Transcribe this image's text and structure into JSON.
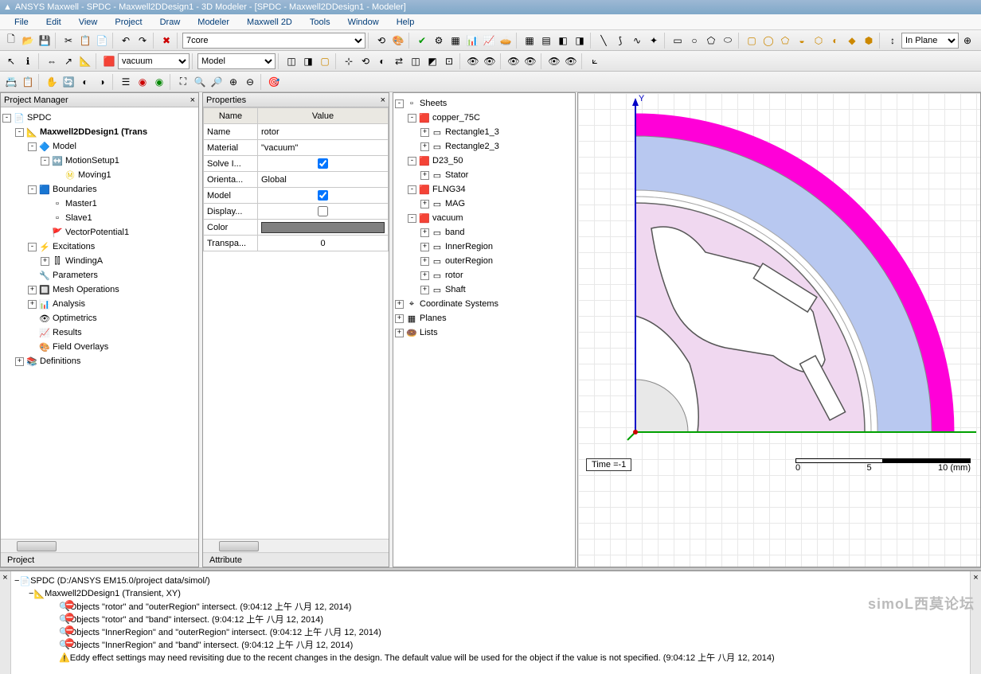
{
  "title": "ANSYS Maxwell - SPDC - Maxwell2DDesign1 - 3D Modeler - [SPDC - Maxwell2DDesign1 - Modeler]",
  "menu": [
    "File",
    "Edit",
    "View",
    "Project",
    "Draw",
    "Modeler",
    "Maxwell 2D",
    "Tools",
    "Window",
    "Help"
  ],
  "toolbar_dropdowns": {
    "item1": "7core",
    "material": "vacuum",
    "mode": "Model",
    "plane": "In Plane"
  },
  "panels": {
    "project_manager": {
      "title": "Project Manager",
      "tab": "Project"
    },
    "properties": {
      "title": "Properties",
      "tab": "Attribute",
      "headers": [
        "Name",
        "Value"
      ]
    }
  },
  "project_tree": [
    {
      "d": 0,
      "e": "-",
      "ico": "📄",
      "t": "SPDC",
      "bold": false
    },
    {
      "d": 1,
      "e": "-",
      "ico": "📐",
      "t": "Maxwell2DDesign1 (Trans",
      "bold": true
    },
    {
      "d": 2,
      "e": "-",
      "ico": "🔷",
      "t": "Model"
    },
    {
      "d": 3,
      "e": "-",
      "ico": "↔️",
      "t": "MotionSetup1"
    },
    {
      "d": 4,
      "e": "",
      "ico": "Ⓜ",
      "t": "Moving1",
      "color": "#e6c200"
    },
    {
      "d": 2,
      "e": "-",
      "ico": "🟦",
      "t": "Boundaries"
    },
    {
      "d": 3,
      "e": "",
      "ico": "▫",
      "t": "Master1"
    },
    {
      "d": 3,
      "e": "",
      "ico": "▫",
      "t": "Slave1"
    },
    {
      "d": 3,
      "e": "",
      "ico": "🚩",
      "t": "VectorPotential1"
    },
    {
      "d": 2,
      "e": "-",
      "ico": "⚡",
      "t": "Excitations"
    },
    {
      "d": 3,
      "e": "+",
      "ico": "⫿⫿",
      "t": "WindingA"
    },
    {
      "d": 2,
      "e": "",
      "ico": "🔧",
      "t": "Parameters"
    },
    {
      "d": 2,
      "e": "+",
      "ico": "🔲",
      "t": "Mesh Operations"
    },
    {
      "d": 2,
      "e": "+",
      "ico": "📊",
      "t": "Analysis"
    },
    {
      "d": 2,
      "e": "",
      "ico": "👁",
      "t": "Optimetrics"
    },
    {
      "d": 2,
      "e": "",
      "ico": "📈",
      "t": "Results"
    },
    {
      "d": 2,
      "e": "",
      "ico": "🎨",
      "t": "Field Overlays"
    },
    {
      "d": 1,
      "e": "+",
      "ico": "📚",
      "t": "Definitions"
    }
  ],
  "properties_rows": [
    {
      "name": "Name",
      "value": "rotor",
      "type": "text"
    },
    {
      "name": "Material",
      "value": "\"vacuum\"",
      "type": "text"
    },
    {
      "name": "Solve I...",
      "value": true,
      "type": "check"
    },
    {
      "name": "Orienta...",
      "value": "Global",
      "type": "text"
    },
    {
      "name": "Model",
      "value": true,
      "type": "check"
    },
    {
      "name": "Display...",
      "value": false,
      "type": "check"
    },
    {
      "name": "Color",
      "value": "#808080",
      "type": "color"
    },
    {
      "name": "Transpa...",
      "value": "0",
      "type": "text"
    }
  ],
  "model_tree": [
    {
      "d": 0,
      "e": "-",
      "ico": "▫",
      "t": "Sheets"
    },
    {
      "d": 1,
      "e": "-",
      "ico": "🟥",
      "t": "copper_75C"
    },
    {
      "d": 2,
      "e": "+",
      "ico": "▭",
      "t": "Rectangle1_3"
    },
    {
      "d": 2,
      "e": "+",
      "ico": "▭",
      "t": "Rectangle2_3"
    },
    {
      "d": 1,
      "e": "-",
      "ico": "🟥",
      "t": "D23_50"
    },
    {
      "d": 2,
      "e": "+",
      "ico": "▭",
      "t": "Stator"
    },
    {
      "d": 1,
      "e": "-",
      "ico": "🟥",
      "t": "FLNG34"
    },
    {
      "d": 2,
      "e": "+",
      "ico": "▭",
      "t": "MAG"
    },
    {
      "d": 1,
      "e": "-",
      "ico": "🟥",
      "t": "vacuum"
    },
    {
      "d": 2,
      "e": "+",
      "ico": "▭",
      "t": "band"
    },
    {
      "d": 2,
      "e": "+",
      "ico": "▭",
      "t": "InnerRegion"
    },
    {
      "d": 2,
      "e": "+",
      "ico": "▭",
      "t": "outerRegion"
    },
    {
      "d": 2,
      "e": "+",
      "ico": "▭",
      "t": "rotor"
    },
    {
      "d": 2,
      "e": "+",
      "ico": "▭",
      "t": "Shaft"
    },
    {
      "d": 0,
      "e": "+",
      "ico": "⌖",
      "t": "Coordinate Systems"
    },
    {
      "d": 0,
      "e": "+",
      "ico": "▦",
      "t": "Planes"
    },
    {
      "d": 0,
      "e": "+",
      "ico": "🍩",
      "t": "Lists"
    }
  ],
  "viewport": {
    "time_label": "Time =-1",
    "scale_unit": "(mm)",
    "scale_ticks": [
      "0",
      "5",
      "10"
    ],
    "axis_y": "Y"
  },
  "messages": {
    "project_line": "SPDC (D:/ANSYS EM15.0/project data/simol/)",
    "design_line": "Maxwell2DDesign1 (Transient, XY)",
    "errors": [
      "Objects \"rotor\" and \"outerRegion\" intersect.  (9:04:12 上午  八月 12, 2014)",
      "Objects \"rotor\" and \"band\" intersect.  (9:04:12 上午  八月 12, 2014)",
      "Objects \"InnerRegion\" and \"outerRegion\" intersect.  (9:04:12 上午  八月 12, 2014)",
      "Objects \"InnerRegion\" and \"band\" intersect.  (9:04:12 上午  八月 12, 2014)"
    ],
    "warning": "Eddy effect settings may need revisiting due to the recent changes in the design.  The default value will be used for the object if the value is not specified.  (9:04:12 上午  八月 12, 2014)"
  },
  "watermark": "simoL西莫论坛"
}
